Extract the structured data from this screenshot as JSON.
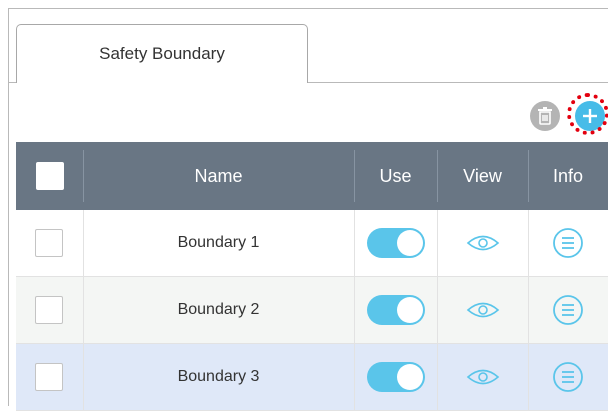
{
  "tabs": [
    {
      "label": "Safety Boundary",
      "active": true
    }
  ],
  "toolbar": {
    "delete_icon": "trash-icon",
    "add_icon": "plus-icon",
    "add_highlighted": true
  },
  "table": {
    "columns": [
      "Name",
      "Use",
      "View",
      "Info"
    ],
    "rows": [
      {
        "name": "Boundary 1",
        "checked": false,
        "use": true,
        "selected": false
      },
      {
        "name": "Boundary 2",
        "checked": false,
        "use": true,
        "selected": false
      },
      {
        "name": "Boundary 3",
        "checked": false,
        "use": true,
        "selected": true
      }
    ]
  },
  "colors": {
    "header_bg": "#697684",
    "accent_blue": "#47bce8",
    "toggle_on": "#5ac5ea",
    "icon_blue": "#5ac5ea",
    "delete_gray": "#b4b4b4",
    "highlight_red": "#e3000f",
    "row_alt": "#f4f6f4",
    "row_selected": "#dfe8f8"
  }
}
